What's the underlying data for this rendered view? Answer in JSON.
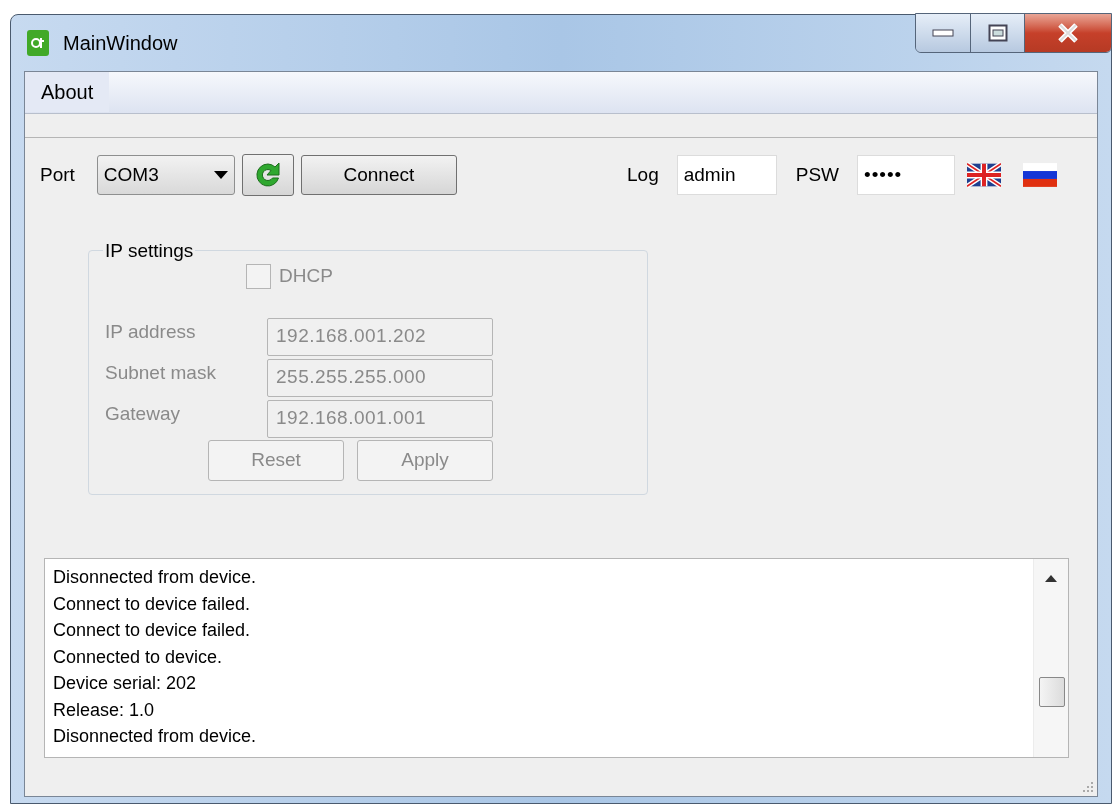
{
  "window": {
    "title": "MainWindow"
  },
  "menu": [
    {
      "label": "About"
    }
  ],
  "connection": {
    "port_label": "Port",
    "port_value": "COM3",
    "connect_button": "Connect",
    "login_label": "Log",
    "login_value": "admin",
    "password_label": "PSW",
    "password_value": "•••••"
  },
  "ip_settings": {
    "title": "IP settings",
    "disabled": true,
    "dhcp": {
      "label": "DHCP",
      "checked": false
    },
    "fields": [
      {
        "label": "IP address",
        "value": "192.168.001.202"
      },
      {
        "label": "Subnet mask",
        "value": "255.255.255.000"
      },
      {
        "label": "Gateway",
        "value": "192.168.001.001"
      }
    ],
    "buttons": [
      "Reset",
      "Apply"
    ]
  },
  "log": [
    "Disonnected from device.",
    "Connect to device failed.",
    "Connect to device failed.",
    "Connected to device.",
    "Device serial: 202",
    "Release: 1.0",
    "Disonnected from device."
  ]
}
